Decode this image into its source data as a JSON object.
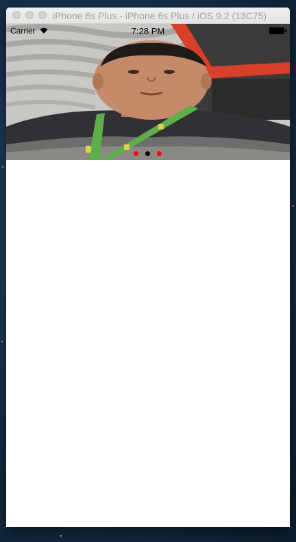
{
  "window": {
    "title": "iPhone 6s Plus - iPhone 6s Plus / iOS 9.2 (13C75)",
    "traffic_lights": [
      "close-button",
      "minimize-button",
      "zoom-button"
    ]
  },
  "status_bar": {
    "carrier": "Carrier",
    "time": "7:28 PM",
    "wifi_icon": "wifi-icon",
    "battery_icon": "battery-icon"
  },
  "carousel": {
    "page_count": 3,
    "current_page": 2,
    "dot_colors": {
      "inactive": "#ff0000",
      "active": "#000000"
    }
  },
  "colors": {
    "screen_background": "#ffffff",
    "desktop_background": "#17324d"
  }
}
